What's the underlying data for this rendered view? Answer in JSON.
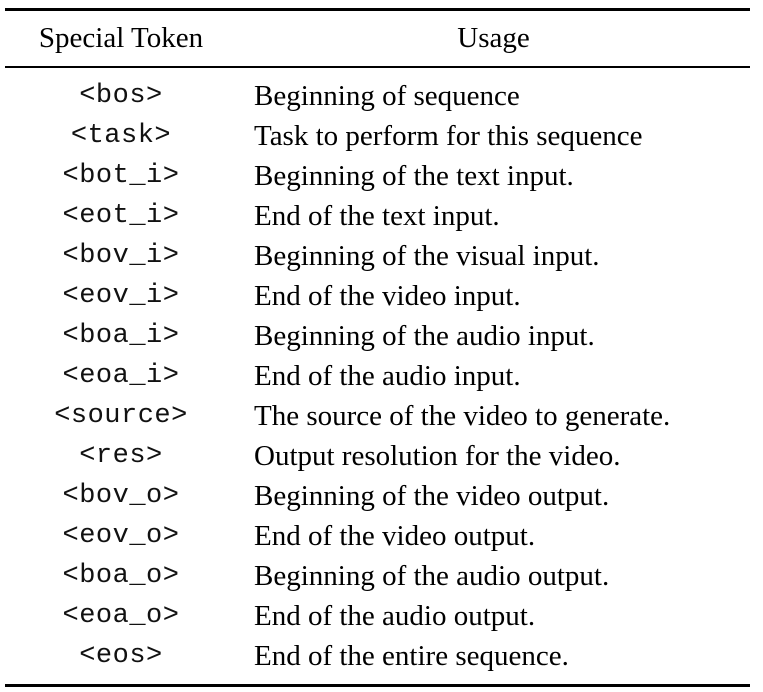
{
  "table": {
    "headers": {
      "token": "Special Token",
      "usage": "Usage"
    },
    "rows": [
      {
        "token": "<bos>",
        "usage": "Beginning of sequence"
      },
      {
        "token": "<task>",
        "usage": "Task to perform for this sequence"
      },
      {
        "token": "<bot_i>",
        "usage": "Beginning of the text input."
      },
      {
        "token": "<eot_i>",
        "usage": "End of the text input."
      },
      {
        "token": "<bov_i>",
        "usage": "Beginning of the visual input."
      },
      {
        "token": "<eov_i>",
        "usage": "End of the video input."
      },
      {
        "token": "<boa_i>",
        "usage": "Beginning of the audio input."
      },
      {
        "token": "<eoa_i>",
        "usage": "End of the audio input."
      },
      {
        "token": "<source>",
        "usage": "The source of the video to generate."
      },
      {
        "token": "<res>",
        "usage": "Output resolution for the video."
      },
      {
        "token": "<bov_o>",
        "usage": "Beginning of the video output."
      },
      {
        "token": "<eov_o>",
        "usage": "End of the video output."
      },
      {
        "token": "<boa_o>",
        "usage": "Beginning of the audio output."
      },
      {
        "token": "<eoa_o>",
        "usage": "End of the audio output."
      },
      {
        "token": "<eos>",
        "usage": "End of the entire sequence."
      }
    ]
  }
}
